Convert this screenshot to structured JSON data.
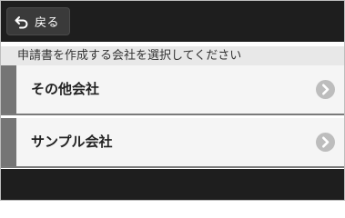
{
  "header": {
    "back_label": "戻る",
    "back_icon": "back-arrow-icon"
  },
  "instruction": "申請書を作成する会社を選択してください",
  "companies": [
    {
      "label": "その他会社",
      "icon": "chevron-right-icon"
    },
    {
      "label": "サンプル会社",
      "icon": "chevron-right-icon"
    }
  ],
  "colors": {
    "header_background": "#1e1e1e",
    "accent": "#757575",
    "list_background": "#f5f5f5",
    "instruction_background": "#e8e8e8"
  }
}
